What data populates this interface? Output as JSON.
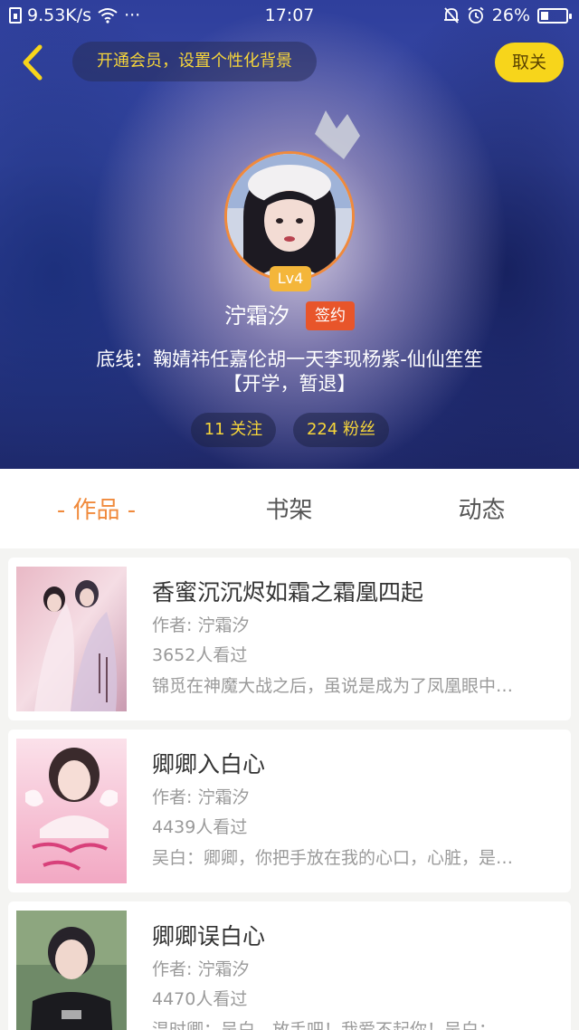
{
  "status_bar": {
    "network_speed": "9.53K/s",
    "dots": "···",
    "time": "17:07",
    "battery": "26%"
  },
  "header": {
    "member_prompt": "开通会员，设置个性化背景",
    "unfollow_label": "取关"
  },
  "profile": {
    "level": "Lv4",
    "name": "泞霜汐",
    "sign_badge": "签约",
    "bio_line1": "底线：鞠婧祎任嘉伦胡一天李现杨紫-仙仙笙笙",
    "bio_line2": "【开学，暂退】",
    "following": "11 关注",
    "followers": "224 粉丝"
  },
  "tabs": [
    {
      "label": "- 作品 -",
      "active": true
    },
    {
      "label": "书架",
      "active": false
    },
    {
      "label": "动态",
      "active": false
    }
  ],
  "books": [
    {
      "title": "香蜜沉沉烬如霜之霜凰四起",
      "author": "作者: 泞霜汐",
      "views": "3652人看过",
      "excerpt": "锦觅在神魔大战之后，虽说是成为了凤凰眼中…"
    },
    {
      "title": "卿卿入白心",
      "author": "作者: 泞霜汐",
      "views": "4439人看过",
      "excerpt": "吴白：卿卿，你把手放在我的心口，心脏，是…"
    },
    {
      "title": "卿卿误白心",
      "author": "作者: 泞霜汐",
      "views": "4470人看过",
      "excerpt": "温时卿：吴白，放手吧！我爱不起你！吴白：…"
    }
  ],
  "colors": {
    "accent_orange": "#f08a3c",
    "accent_yellow": "#f7d51b",
    "sign_red": "#e8552a",
    "level_gold": "#f4b63a"
  },
  "icons": {
    "back": "chevron-left-icon",
    "crown": "crown-icon",
    "wifi": "wifi-icon",
    "mute": "bell-off-icon",
    "alarm": "alarm-icon"
  }
}
